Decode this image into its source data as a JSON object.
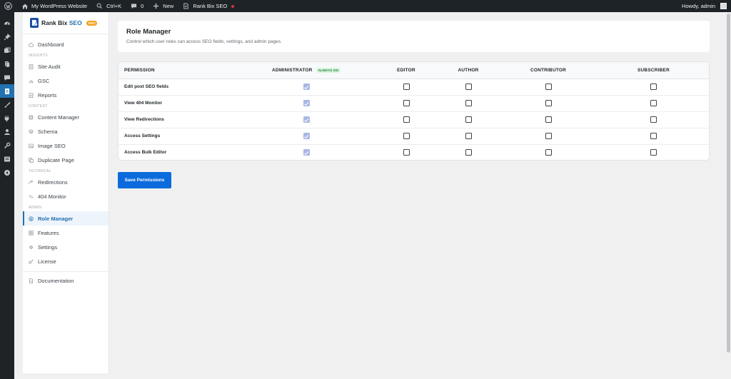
{
  "adminbar": {
    "site_name": "My WordPress Website",
    "shortcut": "Ctrl+K",
    "comments_count": "0",
    "new_label": "New",
    "plugin_label": "Rank Bix SEO",
    "greeting": "Howdy, admin"
  },
  "brand": {
    "name": "Rank Bix",
    "name_accent": "SEO",
    "badge": "PRO"
  },
  "sidebar": {
    "dashboard": "Dashboard",
    "section_insights": "INSIGHTS",
    "site_audit": "Site Audit",
    "gsc": "GSC",
    "reports": "Reports",
    "section_content": "CONTENT",
    "content_manager": "Content Manager",
    "schema": "Schema",
    "image_seo": "Image SEO",
    "duplicate_page": "Duplicate Page",
    "section_technical": "TECHNICAL",
    "redirections": "Redirections",
    "monitor_404": "404 Monitor",
    "section_admin": "ADMIN",
    "role_manager": "Role Manager",
    "features": "Features",
    "settings": "Settings",
    "license": "License",
    "documentation": "Documentation"
  },
  "header": {
    "title": "Role Manager",
    "description": "Control which user roles can access SEO fields, settings, and admin pages."
  },
  "table": {
    "col_permission": "PERMISSION",
    "col_administrator": "ADMINISTRATOR",
    "always_on": "ALWAYS ON",
    "col_editor": "EDITOR",
    "col_author": "AUTHOR",
    "col_contributor": "CONTRIBUTOR",
    "col_subscriber": "SUBSCRIBER",
    "rows": [
      {
        "label": "Edit post SEO fields",
        "administrator": true,
        "editor": false,
        "author": false,
        "contributor": false,
        "subscriber": false
      },
      {
        "label": "View 404 Monitor",
        "administrator": true,
        "editor": false,
        "author": false,
        "contributor": false,
        "subscriber": false
      },
      {
        "label": "View Redirections",
        "administrator": true,
        "editor": false,
        "author": false,
        "contributor": false,
        "subscriber": false
      },
      {
        "label": "Access Settings",
        "administrator": true,
        "editor": false,
        "author": false,
        "contributor": false,
        "subscriber": false
      },
      {
        "label": "Access Bulk Editor",
        "administrator": true,
        "editor": false,
        "author": false,
        "contributor": false,
        "subscriber": false
      }
    ]
  },
  "actions": {
    "save_label": "Save Permissions"
  },
  "colors": {
    "accent": "#2271b1",
    "button": "#0b6bdc",
    "adminbar_bg": "#1d2327",
    "badge_pro": "#f0a21f",
    "always_on_bg": "#d7f5df"
  }
}
